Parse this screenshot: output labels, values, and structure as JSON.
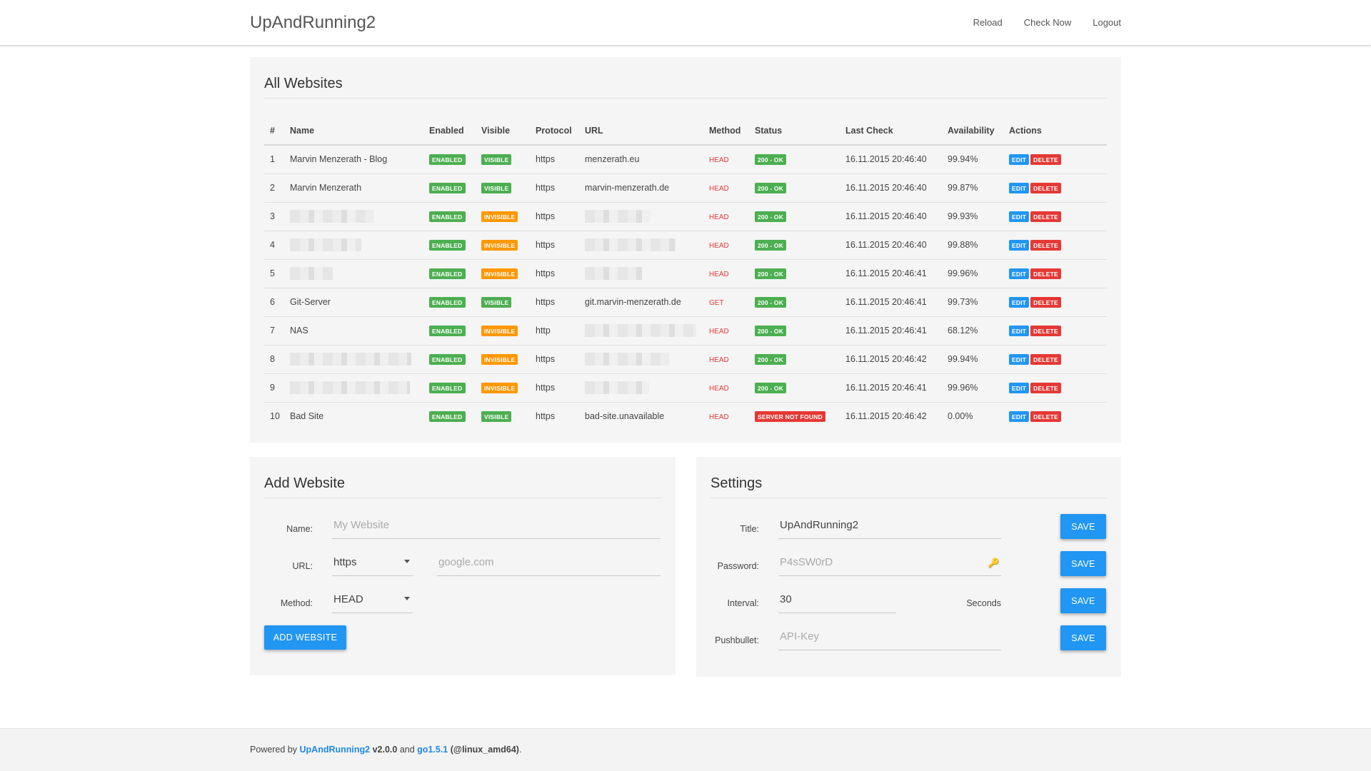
{
  "header": {
    "brand": "UpAndRunning2",
    "links": [
      "Reload",
      "Check Now",
      "Logout"
    ]
  },
  "websites": {
    "title": "All Websites",
    "columns": [
      "#",
      "Name",
      "Enabled",
      "Visible",
      "Protocol",
      "URL",
      "Method",
      "Status",
      "Last Check",
      "Availability",
      "Actions"
    ],
    "rows": [
      {
        "id": "1",
        "name": "Marvin Menzerath - Blog",
        "enabled": "ENABLED",
        "visible": "VISIBLE",
        "protocol": "https",
        "url": "menzerath.eu",
        "method": "HEAD",
        "status": "200 - OK",
        "last_check": "16.11.2015 20:46:40",
        "availability": "99.94%"
      },
      {
        "id": "2",
        "name": "Marvin Menzerath",
        "enabled": "ENABLED",
        "visible": "VISIBLE",
        "protocol": "https",
        "url": "marvin-menzerath.de",
        "method": "HEAD",
        "status": "200 - OK",
        "last_check": "16.11.2015 20:46:40",
        "availability": "99.87%"
      },
      {
        "id": "3",
        "name": "",
        "enabled": "ENABLED",
        "visible": "INVISIBLE",
        "protocol": "https",
        "url": "",
        "method": "HEAD",
        "status": "200 - OK",
        "last_check": "16.11.2015 20:46:40",
        "availability": "99.93%"
      },
      {
        "id": "4",
        "name": "",
        "enabled": "ENABLED",
        "visible": "INVISIBLE",
        "protocol": "https",
        "url": "",
        "method": "HEAD",
        "status": "200 - OK",
        "last_check": "16.11.2015 20:46:40",
        "availability": "99.88%"
      },
      {
        "id": "5",
        "name": "",
        "enabled": "ENABLED",
        "visible": "INVISIBLE",
        "protocol": "https",
        "url": "",
        "method": "HEAD",
        "status": "200 - OK",
        "last_check": "16.11.2015 20:46:41",
        "availability": "99.96%"
      },
      {
        "id": "6",
        "name": "Git-Server",
        "enabled": "ENABLED",
        "visible": "VISIBLE",
        "protocol": "https",
        "url": "git.marvin-menzerath.de",
        "method": "GET",
        "status": "200 - OK",
        "last_check": "16.11.2015 20:46:41",
        "availability": "99.73%"
      },
      {
        "id": "7",
        "name": "NAS",
        "enabled": "ENABLED",
        "visible": "INVISIBLE",
        "protocol": "http",
        "url": "",
        "method": "HEAD",
        "status": "200 - OK",
        "last_check": "16.11.2015 20:46:41",
        "availability": "68.12%"
      },
      {
        "id": "8",
        "name": "",
        "enabled": "ENABLED",
        "visible": "INVISIBLE",
        "protocol": "https",
        "url": "",
        "method": "HEAD",
        "status": "200 - OK",
        "last_check": "16.11.2015 20:46:42",
        "availability": "99.94%"
      },
      {
        "id": "9",
        "name": "",
        "enabled": "ENABLED",
        "visible": "INVISIBLE",
        "protocol": "https",
        "url": "",
        "method": "HEAD",
        "status": "200 - OK",
        "last_check": "16.11.2015 20:46:41",
        "availability": "99.96%"
      },
      {
        "id": "10",
        "name": "Bad Site",
        "enabled": "ENABLED",
        "visible": "VISIBLE",
        "protocol": "https",
        "url": "bad-site.unavailable",
        "method": "HEAD",
        "status": "SERVER NOT FOUND",
        "last_check": "16.11.2015 20:46:42",
        "availability": "0.00%"
      }
    ],
    "edit_label": "EDIT",
    "delete_label": "DELETE"
  },
  "add_website": {
    "title": "Add Website",
    "name_label": "Name:",
    "name_placeholder": "My Website",
    "url_label": "URL:",
    "protocol_value": "https",
    "url_placeholder": "google.com",
    "method_label": "Method:",
    "method_value": "HEAD",
    "button": "ADD WEBSITE"
  },
  "settings": {
    "title": "Settings",
    "title_label": "Title:",
    "title_value": "UpAndRunning2",
    "password_label": "Password:",
    "password_placeholder": "P4sSW0rD",
    "interval_label": "Interval:",
    "interval_value": "30",
    "interval_unit": "Seconds",
    "pushbullet_label": "Pushbullet:",
    "pushbullet_placeholder": "API-Key",
    "save_label": "SAVE"
  },
  "footer": {
    "powered_by": "Powered by",
    "app_link": "UpAndRunning2",
    "version": "v2.0.0",
    "and": "and",
    "go_link": "go1.5.1",
    "platform": "(@linux_amd64)",
    "end": "."
  },
  "colors": {
    "green": "#4caf50",
    "orange": "#ff9800",
    "red": "#e53935",
    "blue": "#2196f3"
  }
}
